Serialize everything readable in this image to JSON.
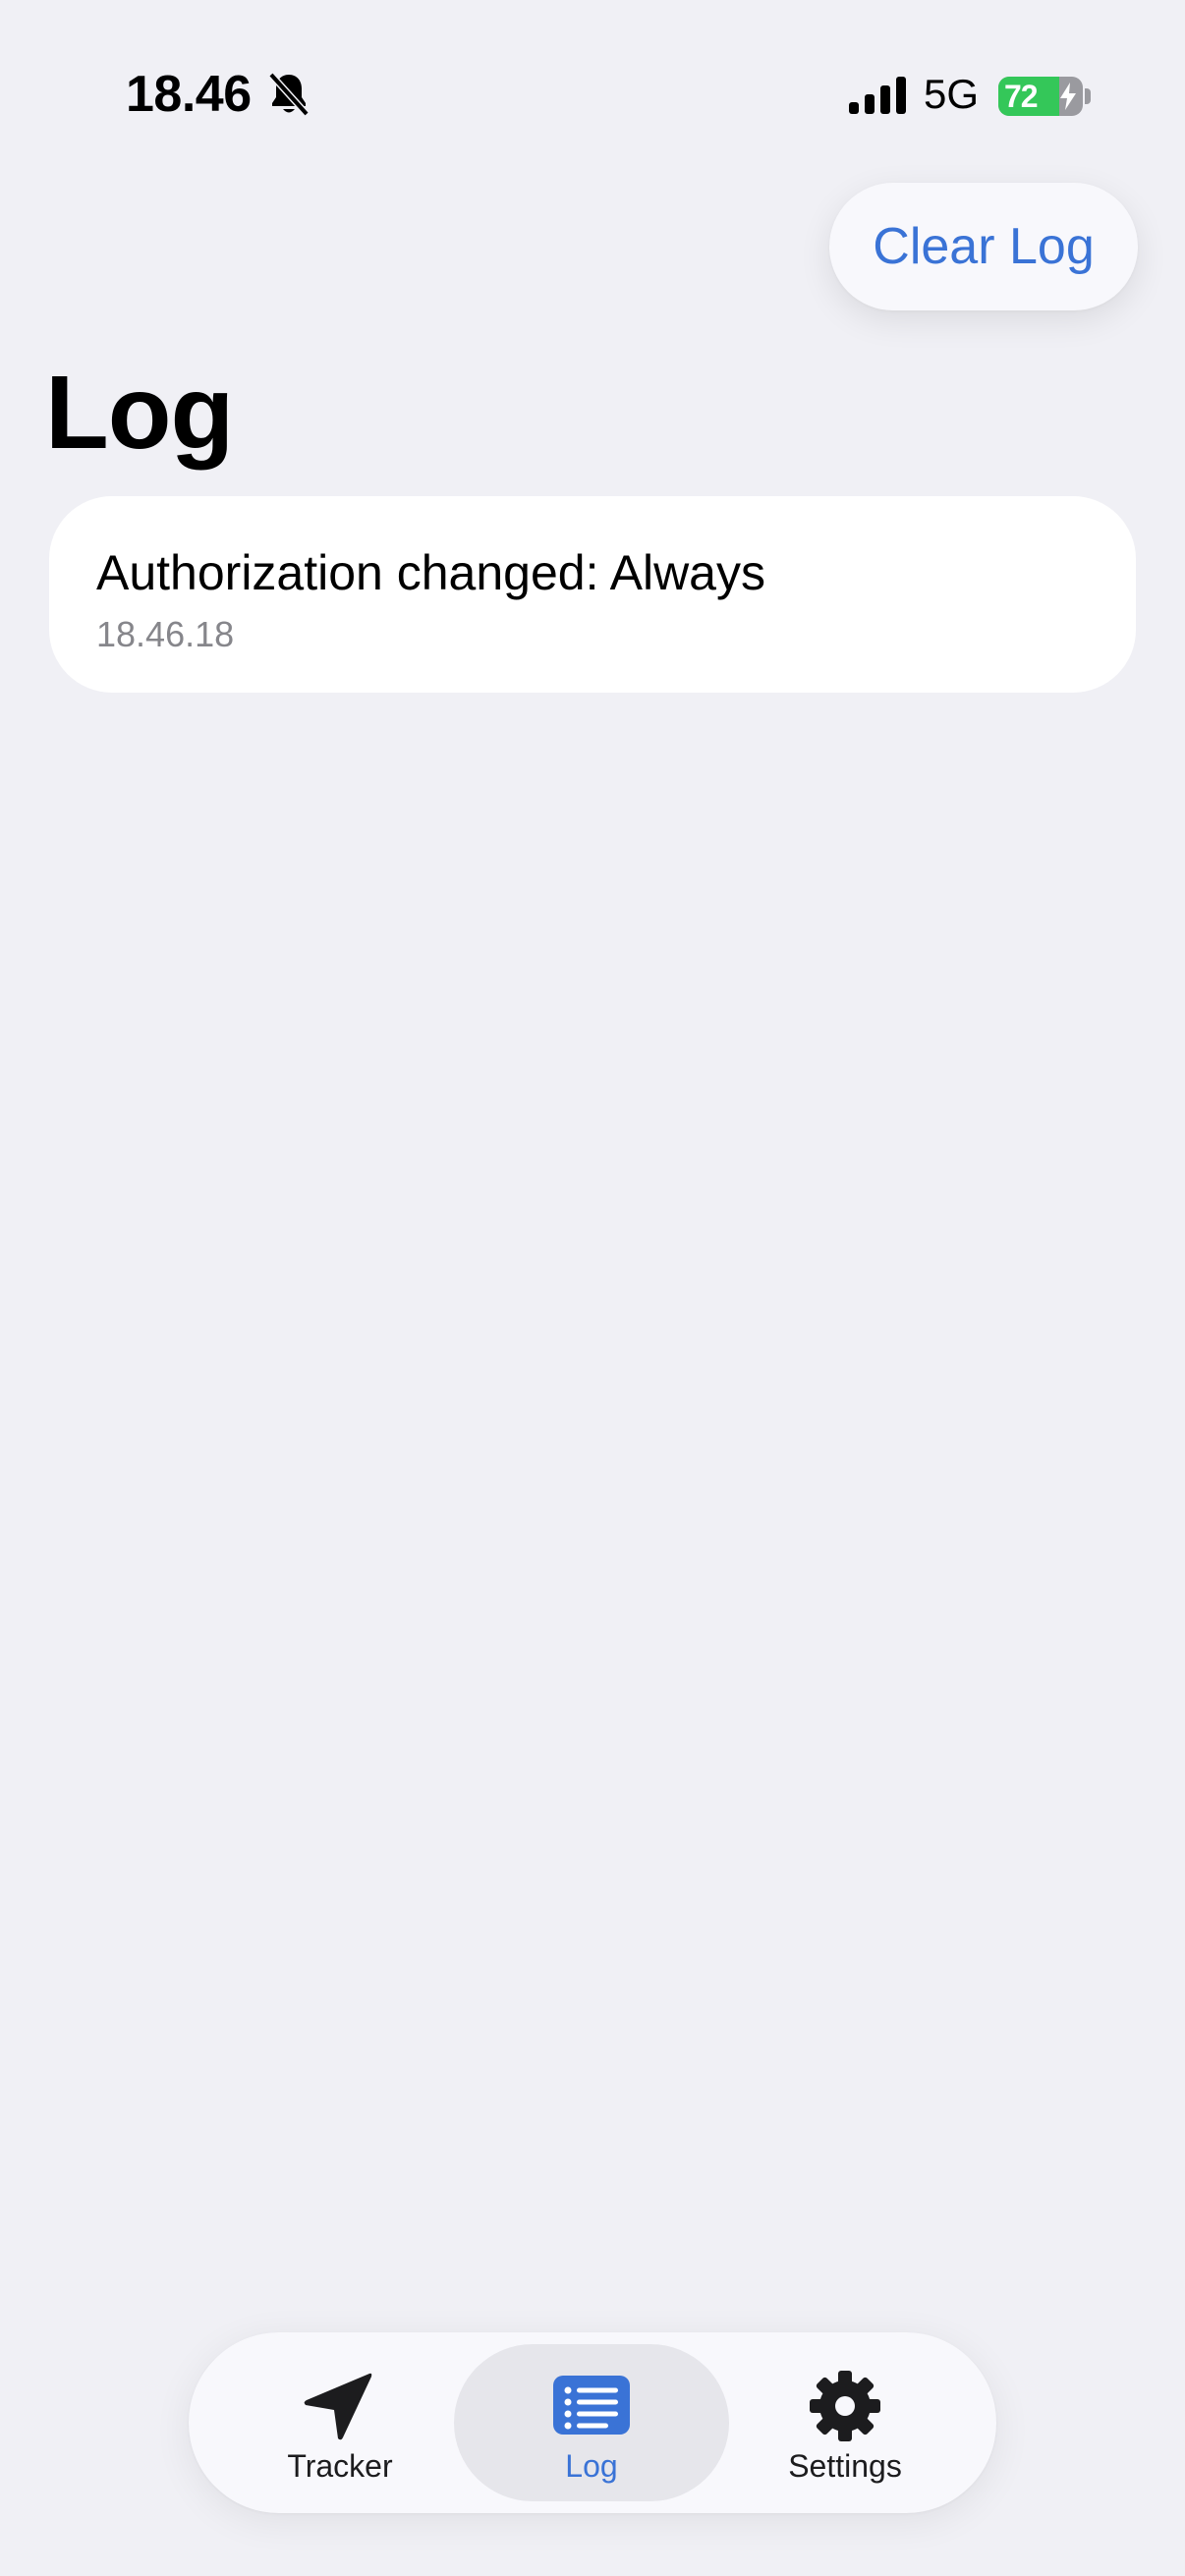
{
  "status_bar": {
    "time": "18.46",
    "network": "5G",
    "battery_level": "72",
    "battery_fraction": 0.72,
    "icons": [
      "bell-slash-icon",
      "signal-bars-icon",
      "battery-charging-icon"
    ]
  },
  "toolbar": {
    "clear_label": "Clear Log"
  },
  "page": {
    "title": "Log"
  },
  "log": {
    "entries": [
      {
        "message": "Authorization changed: Always",
        "timestamp": "18.46.18"
      }
    ]
  },
  "tabs": {
    "items": [
      {
        "label": "Tracker",
        "icon": "location-arrow-icon",
        "selected": false
      },
      {
        "label": "Log",
        "icon": "list-icon",
        "selected": true
      },
      {
        "label": "Settings",
        "icon": "gear-icon",
        "selected": false
      }
    ]
  },
  "colors": {
    "accent": "#3a73d6",
    "background": "#f0f0f5",
    "battery_green": "#34c759"
  }
}
